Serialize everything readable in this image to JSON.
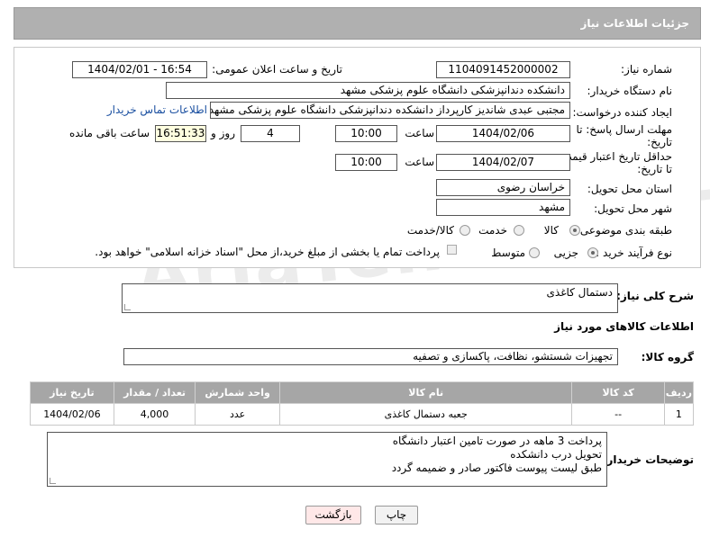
{
  "header": {
    "title": "جزئیات اطلاعات نیاز"
  },
  "watermark": {
    "text": "AriaTender.neT"
  },
  "fields": {
    "need_number": {
      "label": "شماره نیاز:",
      "value": "1104091452000002"
    },
    "announce_datetime": {
      "label": "تاریخ و ساعت اعلان عمومی:",
      "value": "1404/02/01 - 16:54"
    },
    "buyer_org": {
      "label": "نام دستگاه خریدار:",
      "value": "دانشکده دندانپزشکی   دانشگاه علوم پزشکی مشهد"
    },
    "requester": {
      "label": "ایجاد کننده درخواست:",
      "value": "مجتبی عبدی شاندیز کارپرداز دانشکده دندانپزشکی   دانشگاه علوم پزشکی مشهد",
      "contact_link": "اطلاعات تماس خریدار"
    },
    "reply_deadline": {
      "label_line1": "مهلت ارسال پاسخ: تا",
      "label_line2": "تاریخ:",
      "date": "1404/02/06",
      "time_label": "ساعت",
      "time": "10:00",
      "days": "4",
      "days_label": "روز و",
      "remaining": "16:51:33",
      "remaining_label": "ساعت باقی مانده"
    },
    "price_validity": {
      "label_line1": "حداقل تاریخ اعتبار قیمت:",
      "label_line2": "تا تاریخ:",
      "date": "1404/02/07",
      "time_label": "ساعت",
      "time": "10:00"
    },
    "delivery_province": {
      "label": "استان محل تحویل:",
      "value": "خراسان رضوی"
    },
    "delivery_city": {
      "label": "شهر محل تحویل:",
      "value": "مشهد"
    },
    "category": {
      "label": "طبقه بندی موضوعی:",
      "options": [
        "کالا",
        "خدمت",
        "کالا/خدمت"
      ],
      "selected": "کالا"
    },
    "process_type": {
      "label": "نوع فرآیند خرید :",
      "options": [
        "جزیی",
        "متوسط"
      ],
      "selected": "جزیی",
      "payment_note": "پرداخت تمام یا بخشی از مبلغ خرید،از محل \"اسناد خزانه اسلامی\" خواهد بود."
    }
  },
  "description": {
    "label": "شرح کلی نیاز:",
    "value": "دستمال کاغذی"
  },
  "goods_section": {
    "title": "اطلاعات کالاهای مورد نیاز"
  },
  "goods_group": {
    "label": "گروه کالا:",
    "value": "تجهیزات شستشو، نظافت، پاکسازی و تصفیه"
  },
  "table": {
    "headers": [
      "ردیف",
      "کد کالا",
      "نام کالا",
      "واحد شمارش",
      "تعداد / مقدار",
      "تاریخ نیاز"
    ],
    "rows": [
      [
        "1",
        "--",
        "جعبه دستمال کاغذی",
        "عدد",
        "4,000",
        "1404/02/06"
      ]
    ]
  },
  "buyer_notes": {
    "label": "توضیحات خریدار:",
    "lines": [
      "پرداخت 3 ماهه در صورت تامین اعتبار دانشگاه",
      "تحویل درب دانشکده",
      "طبق لیست پیوست فاکتور صادر و ضمیمه گردد"
    ]
  },
  "buttons": {
    "print": "چاپ",
    "back": "بازگشت"
  },
  "colors": {
    "header_bg": "#b0b0b0",
    "table_header_bg": "#a6a6a6",
    "back_button_bg": "#ffe8e8",
    "link": "#1a4fa0"
  }
}
